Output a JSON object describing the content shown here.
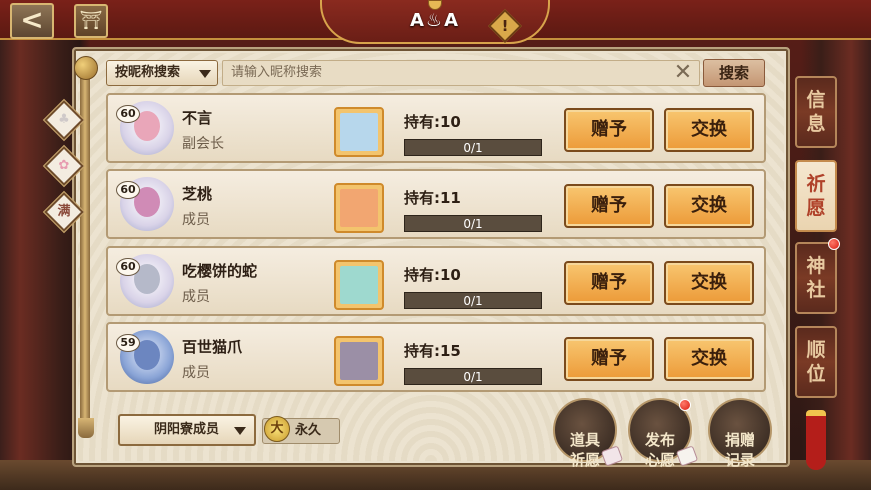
{
  "header": {
    "title": "A‍A",
    "title_text": "A♨A",
    "warn_symbol": "!",
    "back_symbol": "<",
    "guild_symbol": "⛩"
  },
  "search": {
    "type_label": "按昵称搜索",
    "placeholder": "请输入昵称搜索",
    "clear_symbol": "✕",
    "button_label": "搜索"
  },
  "filters": [
    {
      "symbol": "♣",
      "color": "#d9d4d4"
    },
    {
      "symbol": "✿",
      "color": "#e79bb0"
    },
    {
      "symbol": "满",
      "color": "#8a4a3a"
    }
  ],
  "members": [
    {
      "level": "60",
      "name": "不言",
      "role": "副会长",
      "hold": "持有:10",
      "progress_text": "0/1",
      "progress": 0.0,
      "gift_label": "赠予",
      "trade_label": "交换",
      "card_color": "#b7d7ec",
      "avatar_color": "#e9a6b9"
    },
    {
      "level": "60",
      "name": "芝桃",
      "role": "成员",
      "hold": "持有:11",
      "progress_text": "0/1",
      "progress": 0.0,
      "gift_label": "赠予",
      "trade_label": "交换",
      "card_color": "#f2a671",
      "avatar_color": "#d08bb6"
    },
    {
      "level": "60",
      "name": "吃樱饼的蛇",
      "role": "成员",
      "hold": "持有:10",
      "progress_text": "0/1",
      "progress": 0.0,
      "gift_label": "赠予",
      "trade_label": "交换",
      "card_color": "#9ed9cf",
      "avatar_color": "#b5b9c9"
    },
    {
      "level": "59",
      "name": "百世猫爪",
      "role": "成员",
      "hold": "持有:15",
      "progress_text": "0/1",
      "progress": 0.0,
      "gift_label": "赠予",
      "trade_label": "交换",
      "card_color": "#9b8fa6",
      "avatar_color": "#6c86c0"
    }
  ],
  "bottom": {
    "member_filter": "阴阳寮成员",
    "forever_icon": "大",
    "forever_label": "永久",
    "item_wish": "道具\n祈愿",
    "publish_wish": "发布\n心愿",
    "donate_log": "捐赠\n记录"
  },
  "side_tabs": [
    {
      "label": "信\n息",
      "active": false
    },
    {
      "label": "祈\n愿",
      "active": true
    },
    {
      "label": "神\n社",
      "active": false,
      "badge": true
    },
    {
      "label": "顺\n位",
      "active": false
    }
  ],
  "colors": {
    "accent_orange": "#ec9a38",
    "panel_bg": "#ece3d0",
    "notify_red": "#d81b10"
  }
}
